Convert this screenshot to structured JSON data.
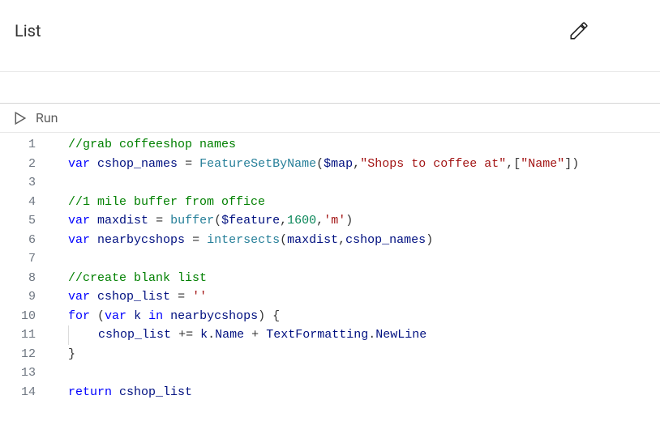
{
  "header": {
    "title": "List",
    "edit_aria": "Edit"
  },
  "toolbar": {
    "run_label": "Run"
  },
  "editor": {
    "line_numbers": [
      "1",
      "2",
      "3",
      "4",
      "5",
      "6",
      "7",
      "8",
      "9",
      "10",
      "11",
      "12",
      "13",
      "14"
    ],
    "lines": [
      {
        "tokens": [
          {
            "cls": "tok-comment",
            "t": "//grab coffeeshop names"
          }
        ]
      },
      {
        "tokens": [
          {
            "cls": "tok-keyword",
            "t": "var"
          },
          {
            "cls": "tok-punc",
            "t": " "
          },
          {
            "cls": "tok-var",
            "t": "cshop_names"
          },
          {
            "cls": "tok-punc",
            "t": " "
          },
          {
            "cls": "tok-op",
            "t": "="
          },
          {
            "cls": "tok-punc",
            "t": " "
          },
          {
            "cls": "tok-func",
            "t": "FeatureSetByName"
          },
          {
            "cls": "tok-punc",
            "t": "("
          },
          {
            "cls": "tok-globalvar",
            "t": "$map"
          },
          {
            "cls": "tok-punc",
            "t": ","
          },
          {
            "cls": "tok-string",
            "t": "\"Shops to coffee at\""
          },
          {
            "cls": "tok-punc",
            "t": ","
          },
          {
            "cls": "tok-punc",
            "t": "["
          },
          {
            "cls": "tok-string",
            "t": "\"Name\""
          },
          {
            "cls": "tok-punc",
            "t": "]"
          },
          {
            "cls": "tok-punc",
            "t": ")"
          }
        ]
      },
      {
        "tokens": []
      },
      {
        "tokens": [
          {
            "cls": "tok-comment",
            "t": "//1 mile buffer from office"
          }
        ]
      },
      {
        "tokens": [
          {
            "cls": "tok-keyword",
            "t": "var"
          },
          {
            "cls": "tok-punc",
            "t": " "
          },
          {
            "cls": "tok-var",
            "t": "maxdist"
          },
          {
            "cls": "tok-punc",
            "t": " "
          },
          {
            "cls": "tok-op",
            "t": "="
          },
          {
            "cls": "tok-punc",
            "t": " "
          },
          {
            "cls": "tok-func",
            "t": "buffer"
          },
          {
            "cls": "tok-punc",
            "t": "("
          },
          {
            "cls": "tok-globalvar",
            "t": "$feature"
          },
          {
            "cls": "tok-punc",
            "t": ","
          },
          {
            "cls": "tok-number",
            "t": "1600"
          },
          {
            "cls": "tok-punc",
            "t": ","
          },
          {
            "cls": "tok-string",
            "t": "'m'"
          },
          {
            "cls": "tok-punc",
            "t": ")"
          }
        ]
      },
      {
        "tokens": [
          {
            "cls": "tok-keyword",
            "t": "var"
          },
          {
            "cls": "tok-punc",
            "t": " "
          },
          {
            "cls": "tok-var",
            "t": "nearbycshops"
          },
          {
            "cls": "tok-punc",
            "t": " "
          },
          {
            "cls": "tok-op",
            "t": "="
          },
          {
            "cls": "tok-punc",
            "t": " "
          },
          {
            "cls": "tok-func",
            "t": "intersects"
          },
          {
            "cls": "tok-punc",
            "t": "("
          },
          {
            "cls": "tok-var",
            "t": "maxdist"
          },
          {
            "cls": "tok-punc",
            "t": ","
          },
          {
            "cls": "tok-var",
            "t": "cshop_names"
          },
          {
            "cls": "tok-punc",
            "t": ")"
          }
        ]
      },
      {
        "tokens": []
      },
      {
        "tokens": [
          {
            "cls": "tok-comment",
            "t": "//create blank list"
          }
        ]
      },
      {
        "tokens": [
          {
            "cls": "tok-keyword",
            "t": "var"
          },
          {
            "cls": "tok-punc",
            "t": " "
          },
          {
            "cls": "tok-var",
            "t": "cshop_list"
          },
          {
            "cls": "tok-punc",
            "t": " "
          },
          {
            "cls": "tok-op",
            "t": "="
          },
          {
            "cls": "tok-punc",
            "t": " "
          },
          {
            "cls": "tok-string",
            "t": "''"
          }
        ]
      },
      {
        "tokens": [
          {
            "cls": "tok-keyword",
            "t": "for"
          },
          {
            "cls": "tok-punc",
            "t": " ("
          },
          {
            "cls": "tok-keyword",
            "t": "var"
          },
          {
            "cls": "tok-punc",
            "t": " "
          },
          {
            "cls": "tok-var",
            "t": "k"
          },
          {
            "cls": "tok-punc",
            "t": " "
          },
          {
            "cls": "tok-keyword",
            "t": "in"
          },
          {
            "cls": "tok-punc",
            "t": " "
          },
          {
            "cls": "tok-var",
            "t": "nearbycshops"
          },
          {
            "cls": "tok-punc",
            "t": ") {"
          }
        ]
      },
      {
        "indent_guides": 1,
        "tokens": [
          {
            "cls": "tok-punc",
            "t": "   "
          },
          {
            "cls": "tok-var",
            "t": "cshop_list"
          },
          {
            "cls": "tok-punc",
            "t": " "
          },
          {
            "cls": "tok-op",
            "t": "+="
          },
          {
            "cls": "tok-punc",
            "t": " "
          },
          {
            "cls": "tok-var",
            "t": "k"
          },
          {
            "cls": "tok-punc",
            "t": "."
          },
          {
            "cls": "tok-member",
            "t": "Name"
          },
          {
            "cls": "tok-punc",
            "t": " "
          },
          {
            "cls": "tok-op",
            "t": "+"
          },
          {
            "cls": "tok-punc",
            "t": " "
          },
          {
            "cls": "tok-var",
            "t": "TextFormatting"
          },
          {
            "cls": "tok-punc",
            "t": "."
          },
          {
            "cls": "tok-member",
            "t": "NewLine"
          }
        ]
      },
      {
        "tokens": [
          {
            "cls": "tok-punc",
            "t": "}"
          }
        ]
      },
      {
        "tokens": []
      },
      {
        "tokens": [
          {
            "cls": "tok-keyword",
            "t": "return"
          },
          {
            "cls": "tok-punc",
            "t": " "
          },
          {
            "cls": "tok-var",
            "t": "cshop_list"
          }
        ]
      }
    ]
  }
}
